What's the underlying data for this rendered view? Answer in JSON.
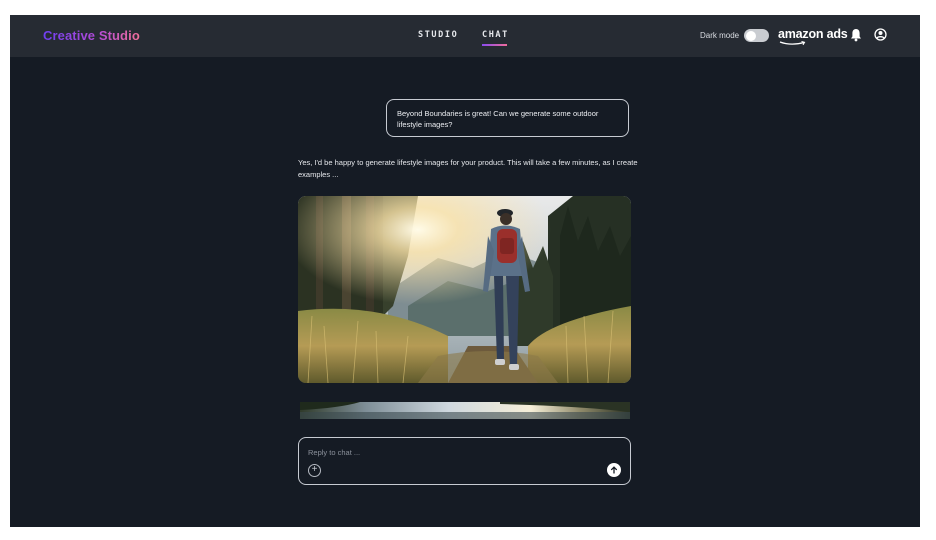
{
  "app": {
    "title": "Creative Studio"
  },
  "nav": {
    "tabs": [
      {
        "label": "STUDIO",
        "active": false
      },
      {
        "label": "CHAT",
        "active": true
      }
    ]
  },
  "header_right": {
    "dark_mode_label": "Dark mode",
    "dark_mode_on": false,
    "brand": "amazon ads",
    "icons": [
      "bell-icon",
      "user-icon"
    ]
  },
  "chat": {
    "user_message": "Beyond Boundaries is great! Can we generate some outdoor lifestyle images?",
    "assistant_message": "Yes, I'd be happy to generate lifestyle images for your product. This will take a few minutes, as I create examples ...",
    "images": [
      "generated-image-hiker",
      "generated-image-lake"
    ]
  },
  "reply": {
    "placeholder": "Reply to chat ...",
    "value": ""
  },
  "colors": {
    "background": "#151b24",
    "header": "#262b33",
    "accent_start": "#8a4bf0",
    "accent_end": "#ef6c9b"
  }
}
